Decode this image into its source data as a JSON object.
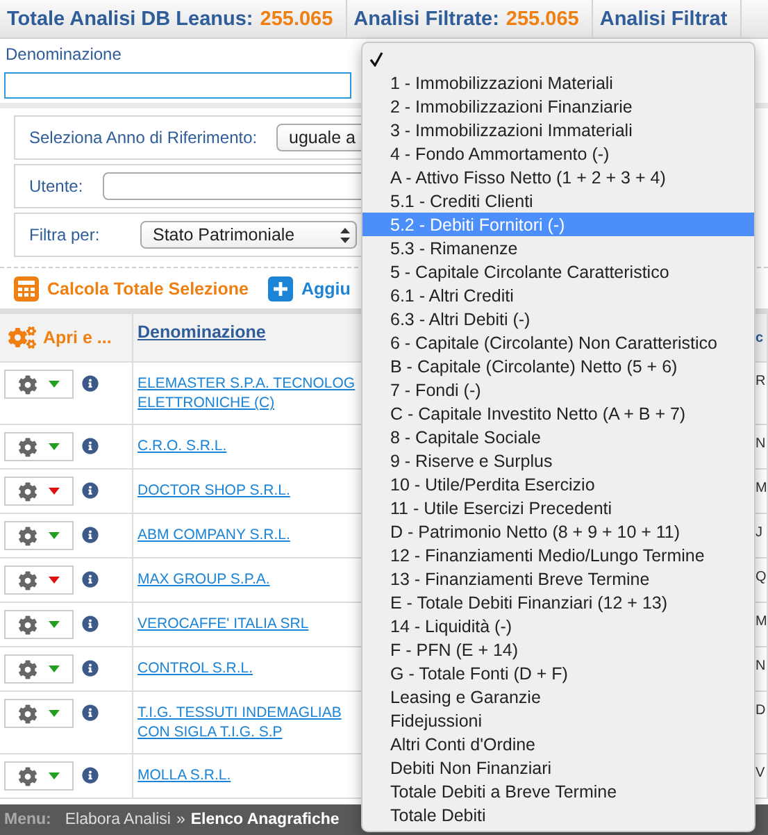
{
  "stats_bar": [
    {
      "label": "Totale Analisi DB Leanus:",
      "value": "255.065"
    },
    {
      "label": "Analisi Filtrate:",
      "value": "255.065"
    },
    {
      "label": "Analisi Filtrat"
    }
  ],
  "search": {
    "label": "Denominazione"
  },
  "filters": [
    {
      "kind": "select",
      "label": "Seleziona Anno di Riferimento:",
      "value": "uguale a"
    },
    {
      "kind": "input",
      "label": "Utente:"
    },
    {
      "kind": "select-stepper",
      "label": "Filtra per:",
      "value": "Stato Patrimoniale"
    }
  ],
  "actions": [
    {
      "kind": "calculator",
      "label": "Calcola Totale Selezione"
    },
    {
      "kind": "add",
      "label": "Aggiu"
    }
  ],
  "table": {
    "columns": [
      "Apri e ...",
      "Denominazione",
      "c"
    ],
    "rows": [
      {
        "color": "#21a021",
        "name": "ELEMASTER S.P.A. TECNOLOG\nELETTRONICHE (C)",
        "column_3": "R"
      },
      {
        "color": "#21a021",
        "name": "C.R.O. S.R.L.",
        "column_3": "N"
      },
      {
        "color": "#e01010",
        "name": "DOCTOR SHOP S.R.L.",
        "column_3": "M"
      },
      {
        "color": "#21a021",
        "name": "ABM COMPANY S.R.L.",
        "column_3": "J"
      },
      {
        "color": "#e01010",
        "name": "MAX GROUP S.P.A.",
        "column_3": "Q"
      },
      {
        "color": "#21a021",
        "name": "VEROCAFFE' ITALIA SRL",
        "column_3": "M"
      },
      {
        "color": "#21a021",
        "name": "CONTROL S.R.L.",
        "column_3": "N"
      },
      {
        "color": "#21a021",
        "name": "T.I.G. TESSUTI INDEMAGLIAB\nCON SIGLA T.I.G. S.P",
        "column_3": "D"
      },
      {
        "color": "#21a021",
        "name": "MOLLA S.R.L.",
        "column_3": "V"
      }
    ]
  },
  "breadcrumb": {
    "label": "Menu:",
    "items": [
      "Elabora Analisi",
      "Elenco Anagrafiche"
    ],
    "separator": "»"
  },
  "dropdown": {
    "options": [
      {
        "checked": true,
        "selected": false
      },
      {
        "label": "1 - Immobilizzazioni Materiali",
        "checked": false,
        "selected": false
      },
      {
        "label": "2 - Immobilizzazioni Finanziarie",
        "checked": false,
        "selected": false
      },
      {
        "label": "3 - Immobilizzazioni Immateriali",
        "checked": false,
        "selected": false
      },
      {
        "label": "4 - Fondo Ammortamento (-)",
        "checked": false,
        "selected": false
      },
      {
        "label": "A - Attivo Fisso Netto (1 + 2 + 3 + 4)",
        "checked": false,
        "selected": false
      },
      {
        "label": "5.1 - Crediti Clienti",
        "checked": false,
        "selected": false
      },
      {
        "label": "5.2 - Debiti Fornitori (-)",
        "checked": false,
        "selected": true
      },
      {
        "label": "5.3 - Rimanenze",
        "checked": false,
        "selected": false
      },
      {
        "label": "5 - Capitale Circolante Caratteristico",
        "checked": false,
        "selected": false
      },
      {
        "label": "6.1 - Altri Crediti",
        "checked": false,
        "selected": false
      },
      {
        "label": "6.3 - Altri Debiti (-)",
        "checked": false,
        "selected": false
      },
      {
        "label": "6 - Capitale (Circolante) Non Caratteristico",
        "checked": false,
        "selected": false
      },
      {
        "label": "B - Capitale (Circolante) Netto (5 + 6)",
        "checked": false,
        "selected": false
      },
      {
        "label": "7 - Fondi (-)",
        "checked": false,
        "selected": false
      },
      {
        "label": "C - Capitale Investito Netto (A + B + 7)",
        "checked": false,
        "selected": false
      },
      {
        "label": "8 - Capitale Sociale",
        "checked": false,
        "selected": false
      },
      {
        "label": "9 - Riserve e Surplus",
        "checked": false,
        "selected": false
      },
      {
        "label": "10 - Utile/Perdita Esercizio",
        "checked": false,
        "selected": false
      },
      {
        "label": "11 - Utile Esercizi Precedenti",
        "checked": false,
        "selected": false
      },
      {
        "label": "D - Patrimonio Netto (8 + 9 + 10 + 11)",
        "checked": false,
        "selected": false
      },
      {
        "label": "12 - Finanziamenti Medio/Lungo Termine",
        "checked": false,
        "selected": false
      },
      {
        "label": "13 - Finanziamenti Breve Termine",
        "checked": false,
        "selected": false
      },
      {
        "label": "E - Totale Debiti Finanziari (12 + 13)",
        "checked": false,
        "selected": false
      },
      {
        "label": "14 - Liquidità (-)",
        "checked": false,
        "selected": false
      },
      {
        "label": "F - PFN (E + 14)",
        "checked": false,
        "selected": false
      },
      {
        "label": "G - Totale Fonti (D + F)",
        "checked": false,
        "selected": false
      },
      {
        "label": "Leasing e Garanzie",
        "checked": false,
        "selected": false
      },
      {
        "label": "Fidejussioni",
        "checked": false,
        "selected": false
      },
      {
        "label": "Altri Conti d'Ordine",
        "checked": false,
        "selected": false
      },
      {
        "label": "Debiti Non Finanziari",
        "checked": false,
        "selected": false
      },
      {
        "label": "Totale Debiti a Breve Termine",
        "checked": false,
        "selected": false
      },
      {
        "label": "Totale Debiti",
        "checked": false,
        "selected": false
      }
    ]
  }
}
